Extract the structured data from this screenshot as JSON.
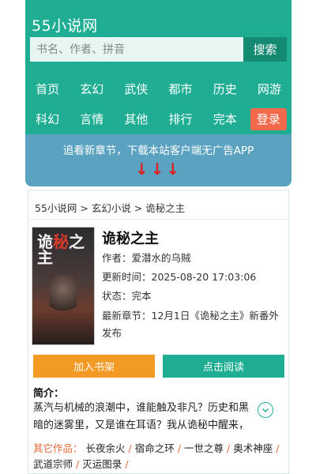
{
  "header": {
    "site_title": "55小说网",
    "search_placeholder": "书名、作者、拼音",
    "search_button": "搜索"
  },
  "nav": {
    "row1": [
      "首页",
      "玄幻",
      "武侠",
      "都市",
      "历史",
      "网游"
    ],
    "row2": [
      "科幻",
      "言情",
      "其他",
      "排行",
      "完本"
    ],
    "login": "登录"
  },
  "promo": {
    "text": "追看新章节，下载本站客户端无广告APP",
    "arrows": "↓↓↓"
  },
  "breadcrumb": "55小说网 > 玄幻小说 > 诡秘之主",
  "book": {
    "title": "诡秘之主",
    "author": "作者：爱潜水的乌贼",
    "updated": "更新时间：2025-08-20 17:03:06",
    "status": "状态：完本",
    "latest": "最新章节：12月1日《诡秘之主》新番外发布",
    "cover_title_1": "诡",
    "cover_title_2": "秘",
    "cover_title_3": "之主"
  },
  "buttons": {
    "shelf": "加入书架",
    "read": "点击阅读"
  },
  "intro": {
    "label": "简介：",
    "text": "蒸汽与机械的浪潮中，谁能触及非凡？历史和黑暗的迷雾里，又是谁在耳语？我从诡秘中醒来，"
  },
  "other_works": {
    "label": "其它作品：",
    "items": [
      "长夜余火",
      "宿命之环",
      "一世之尊",
      "奥术神座",
      "武道宗师",
      "灭运图录"
    ]
  },
  "colors": {
    "brand": "#1fae93",
    "login": "#f2694b",
    "promo": "#5ba2c0",
    "shelf_button": "#f39a24",
    "accent_label": "#e4693a"
  }
}
